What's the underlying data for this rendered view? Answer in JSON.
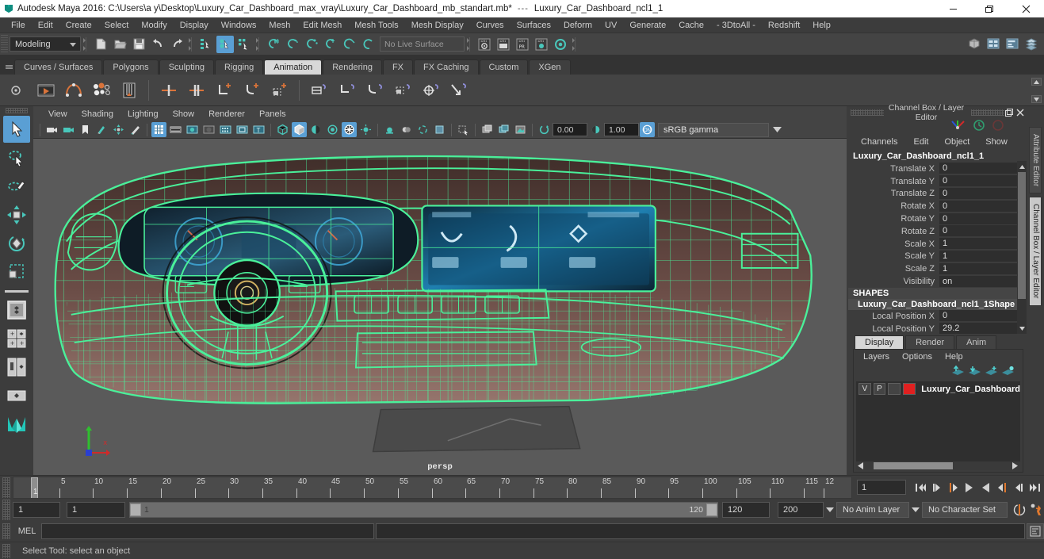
{
  "titlebar": {
    "app_title": "Autodesk Maya 2016: C:\\Users\\a y\\Desktop\\Luxury_Car_Dashboard_max_vray\\Luxury_Car_Dashboard_mb_standart.mb*",
    "separator": "---",
    "selection_name": "Luxury_Car_Dashboard_ncl1_1",
    "minimize": "—",
    "maximize": "❐",
    "close": "✕"
  },
  "menubar": {
    "items": [
      "File",
      "Edit",
      "Create",
      "Select",
      "Modify",
      "Display",
      "Windows",
      "Mesh",
      "Edit Mesh",
      "Mesh Tools",
      "Mesh Display",
      "Curves",
      "Surfaces",
      "Deform",
      "UV",
      "Generate",
      "Cache",
      "- 3DtoAll -",
      "Redshift",
      "Help"
    ]
  },
  "statusline": {
    "mode": "Modeling",
    "live_surface": "No Live Surface",
    "icons": [
      "new-scene-icon",
      "open-scene-icon",
      "save-scene-icon",
      "undo-icon",
      "redo-icon",
      "select-by-hierarchy-icon",
      "select-by-object-icon",
      "select-by-component-icon",
      "snap-to-grid-icon",
      "snap-to-curve-icon",
      "snap-to-point-icon",
      "snap-to-projected-center-icon",
      "snap-to-view-plane-icon",
      "snap-to-live-icon",
      "render-view-icon",
      "render-sequence-icon",
      "ipr-render-icon",
      "render-settings-icon"
    ],
    "right_icons": [
      "show-hide-modeling-toolkit-icon",
      "show-hide-attribute-editor-icon",
      "show-hide-tool-settings-icon",
      "show-hide-channel-box-icon"
    ]
  },
  "shelf": {
    "tabs": [
      "Curves / Surfaces",
      "Polygons",
      "Sculpting",
      "Rigging",
      "Animation",
      "Rendering",
      "FX",
      "FX Caching",
      "Custom",
      "XGen"
    ],
    "active_tab": "Animation",
    "icons": [
      "playblast-icon",
      "set-key-icon",
      "set-breakdown-key-icon",
      "ghost-selected-icon",
      "set-driven-key-icon",
      "ik-handle-icon",
      "ik-spline-icon",
      "constraint-parent-icon",
      "constraint-point-icon",
      "constraint-orient-icon",
      "constraint-scale-icon",
      "constraint-aim-icon",
      "constraint-pole-vector-icon"
    ]
  },
  "toolbox": {
    "tools": [
      "select-tool",
      "lasso-select-tool",
      "paint-select-tool",
      "move-tool",
      "rotate-tool",
      "scale-tool",
      "last-tool-used",
      "four-view-layout",
      "persp-outliner-layout",
      "persp-graph-layout",
      "single-perspective-layout",
      "maya-logo-icon"
    ],
    "selected": "select-tool"
  },
  "viewport": {
    "panel_menu": [
      "View",
      "Shading",
      "Lighting",
      "Show",
      "Renderer",
      "Panels"
    ],
    "camera_label": "persp",
    "exposure_value": "0.00",
    "gamma_value": "1.00",
    "color_management": "sRGB gamma",
    "toolbar_icons": [
      "select-camera-icon",
      "lock-camera-icon",
      "bookmark-icon",
      "image-plane-icon",
      "two-d-pan-zoom-icon",
      "grease-pencil-icon",
      "grid-icon",
      "film-gate-icon",
      "resolution-gate-icon",
      "gate-mask-icon",
      "field-chart-icon",
      "safe-action-icon",
      "safe-title-icon",
      "wireframe-icon",
      "smooth-shade-all-icon",
      "flat-shade-icon",
      "shade-options-icon",
      "wireframe-on-shaded-icon",
      "x-ray-icon",
      "default-light-icon",
      "all-lights-icon",
      "shadows-icon",
      "ambient-occlusion-icon",
      "motion-blur-icon",
      "multisample-icon",
      "isolate-select-icon",
      "display-textures-icon",
      "exposure-icon",
      "gamma-icon",
      "color-management-icon"
    ],
    "model": {
      "object": "Luxury Car Dashboard",
      "shading": "wireframe-on-shaded",
      "wireframe_color": "#4af09a",
      "selected": true
    }
  },
  "channel_box": {
    "panel_title": "Channel Box / Layer Editor",
    "menus": [
      "Channels",
      "Edit",
      "Object",
      "Show"
    ],
    "object_name": "Luxury_Car_Dashboard_ncl1_1",
    "attributes": [
      {
        "label": "Translate X",
        "value": "0"
      },
      {
        "label": "Translate Y",
        "value": "0"
      },
      {
        "label": "Translate Z",
        "value": "0"
      },
      {
        "label": "Rotate X",
        "value": "0"
      },
      {
        "label": "Rotate Y",
        "value": "0"
      },
      {
        "label": "Rotate Z",
        "value": "0"
      },
      {
        "label": "Scale X",
        "value": "1"
      },
      {
        "label": "Scale Y",
        "value": "1"
      },
      {
        "label": "Scale Z",
        "value": "1"
      },
      {
        "label": "Visibility",
        "value": "on"
      }
    ],
    "shapes_header": "SHAPES",
    "shape_name": "Luxury_Car_Dashboard_ncl1_1Shape",
    "shape_attributes": [
      {
        "label": "Local Position X",
        "value": "0"
      },
      {
        "label": "Local Position Y",
        "value": "29.2"
      }
    ]
  },
  "layer_editor": {
    "tabs": [
      "Display",
      "Render",
      "Anim"
    ],
    "active_tab": "Display",
    "menus": [
      "Layers",
      "Options",
      "Help"
    ],
    "toolbar_icons": [
      "move-layer-up-icon",
      "move-layer-down-icon",
      "new-layer-icon",
      "new-layer-from-selected-icon"
    ],
    "layers": [
      {
        "visibility": "V",
        "playback": "P",
        "state": "",
        "color": "#e02020",
        "name": "Luxury_Car_Dashboard"
      }
    ]
  },
  "side_tabs": {
    "items": [
      "Attribute Editor",
      "Channel Box / Layer Editor"
    ],
    "active": "Channel Box / Layer Editor"
  },
  "time_slider": {
    "ticks": [
      "5",
      "10",
      "15",
      "20",
      "25",
      "30",
      "35",
      "40",
      "45",
      "50",
      "55",
      "60",
      "65",
      "70",
      "75",
      "80",
      "85",
      "90",
      "95",
      "100",
      "105",
      "110",
      "115",
      "12"
    ],
    "current_frame": "1",
    "current_frame_field": "1",
    "playback_buttons": [
      "go-to-start-icon",
      "step-back-frame-icon",
      "step-back-key-icon",
      "play-backwards-icon",
      "play-forwards-icon",
      "step-forward-key-icon",
      "step-forward-frame-icon",
      "go-to-end-icon"
    ]
  },
  "range_slider": {
    "anim_start": "1",
    "range_start": "1",
    "bar_start_label": "1",
    "bar_end_label": "120",
    "range_end": "120",
    "anim_end": "200",
    "anim_layer": "No Anim Layer",
    "character_set": "No Character Set",
    "icons": [
      "auto-key-icon",
      "animation-preferences-icon"
    ]
  },
  "command_line": {
    "label": "MEL",
    "input_value": "",
    "output_value": "",
    "script_editor_icon": "script-editor-icon"
  },
  "help_line": {
    "message": "Select Tool: select an object"
  },
  "colors": {
    "accent_blue": "#5a9fd4",
    "teal": "#3fbfb0",
    "orange": "#d9733a",
    "layer_red": "#e02020",
    "wireframe_green": "#4af09a"
  }
}
